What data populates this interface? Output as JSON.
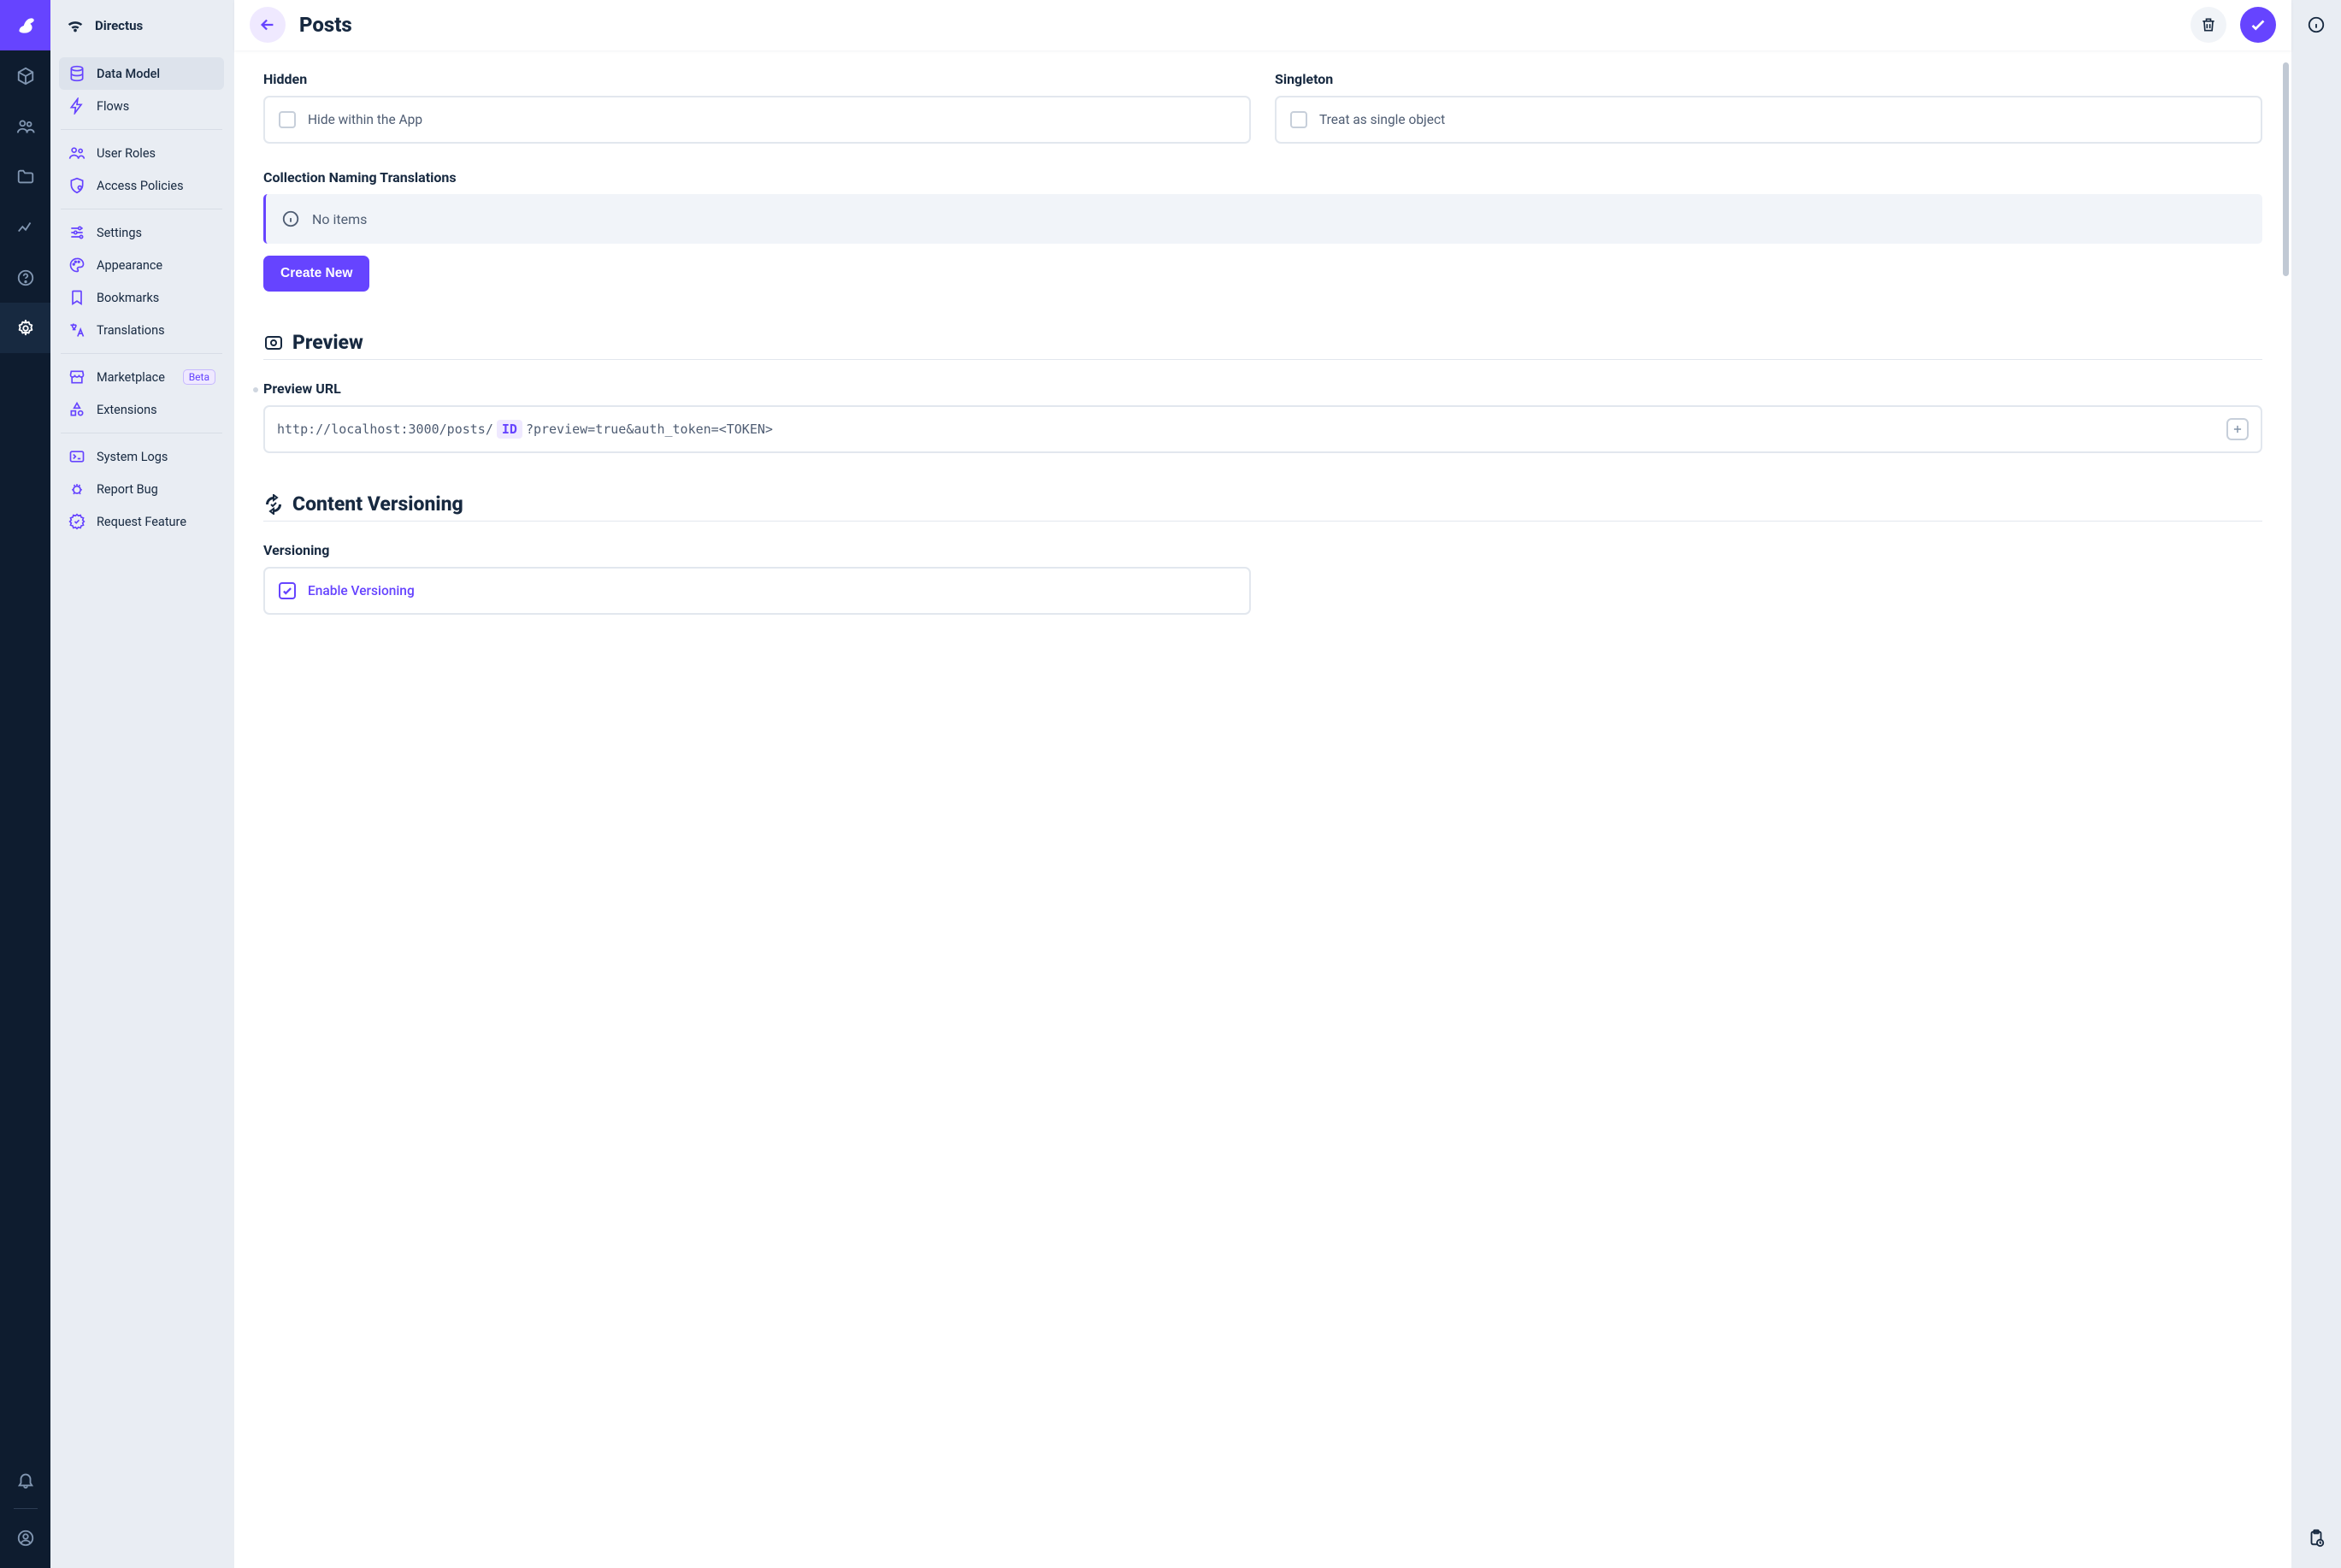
{
  "app_name": "Directus",
  "page": {
    "title": "Posts"
  },
  "nav": {
    "items": [
      {
        "label": "Data Model",
        "active": true
      },
      {
        "label": "Flows"
      },
      {
        "sep": true
      },
      {
        "label": "User Roles"
      },
      {
        "label": "Access Policies"
      },
      {
        "sep": true
      },
      {
        "label": "Settings"
      },
      {
        "label": "Appearance"
      },
      {
        "label": "Bookmarks"
      },
      {
        "label": "Translations"
      },
      {
        "sep": true
      },
      {
        "label": "Marketplace",
        "badge": "Beta"
      },
      {
        "label": "Extensions"
      },
      {
        "sep": true
      },
      {
        "label": "System Logs"
      },
      {
        "label": "Report Bug"
      },
      {
        "label": "Request Feature"
      }
    ]
  },
  "fields": {
    "hidden": {
      "label": "Hidden",
      "option": "Hide within the App",
      "checked": false
    },
    "singleton": {
      "label": "Singleton",
      "option": "Treat as single object",
      "checked": false
    },
    "translations": {
      "label": "Collection Naming Translations",
      "empty": "No items",
      "create": "Create New"
    },
    "preview": {
      "section": "Preview",
      "url_label": "Preview URL",
      "url_before": "http://localhost:3000/posts/",
      "url_chip": "ID",
      "url_after": "?preview=true&auth_token=<TOKEN>"
    },
    "versioning": {
      "section": "Content Versioning",
      "label": "Versioning",
      "option": "Enable Versioning",
      "checked": true
    }
  }
}
